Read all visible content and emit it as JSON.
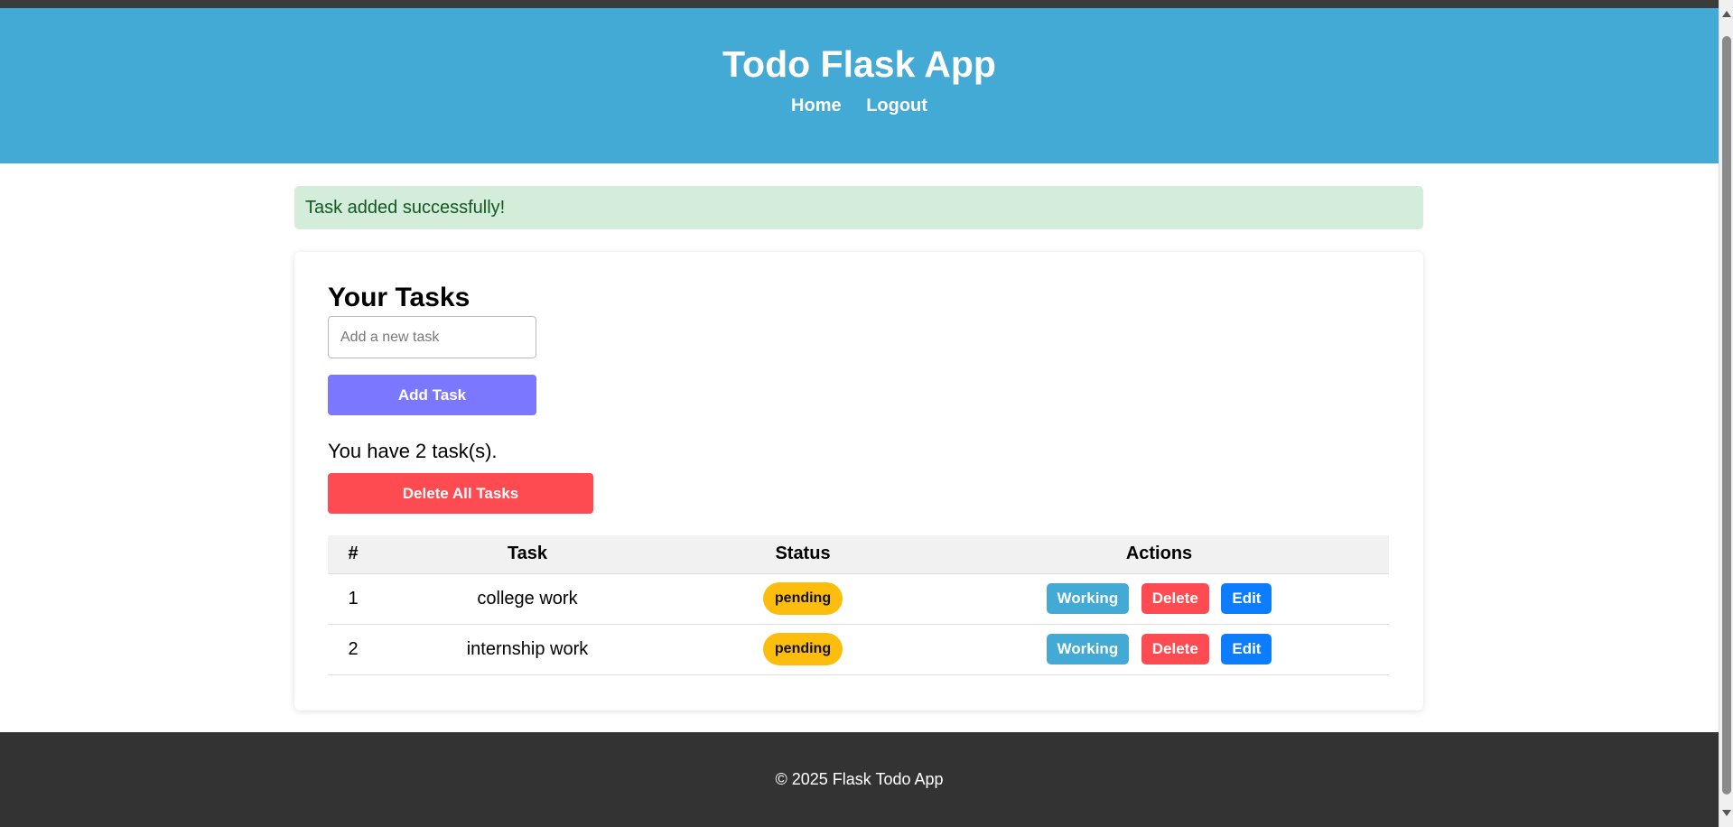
{
  "header": {
    "title": "Todo Flask App",
    "nav": [
      {
        "label": "Home"
      },
      {
        "label": "Logout"
      }
    ]
  },
  "flash": {
    "message": "Task added successfully!"
  },
  "tasks_card": {
    "title": "Your Tasks",
    "input": {
      "value": "",
      "placeholder": "Add a new task"
    },
    "add_label": "Add Task",
    "count_text": "You have 2 task(s).",
    "delete_all_label": "Delete All Tasks",
    "table": {
      "headers": [
        "#",
        "Task",
        "Status",
        "Actions"
      ],
      "rows": [
        {
          "num": "1",
          "task": "college work",
          "status": "pending",
          "actions": {
            "working": "Working",
            "delete": "Delete",
            "edit": "Edit"
          }
        },
        {
          "num": "2",
          "task": "internship work",
          "status": "pending",
          "actions": {
            "working": "Working",
            "delete": "Delete",
            "edit": "Edit"
          }
        }
      ]
    }
  },
  "footer": {
    "text": "© 2025 Flask Todo App"
  },
  "colors": {
    "header_bg": "#42aad4",
    "add_button": "#7b78ff",
    "delete_button": "#fd4b51",
    "edit_button": "#0c7dff",
    "status_pending": "#fcbd0c",
    "flash_bg": "#d4eddb",
    "footer_bg": "#333333"
  }
}
